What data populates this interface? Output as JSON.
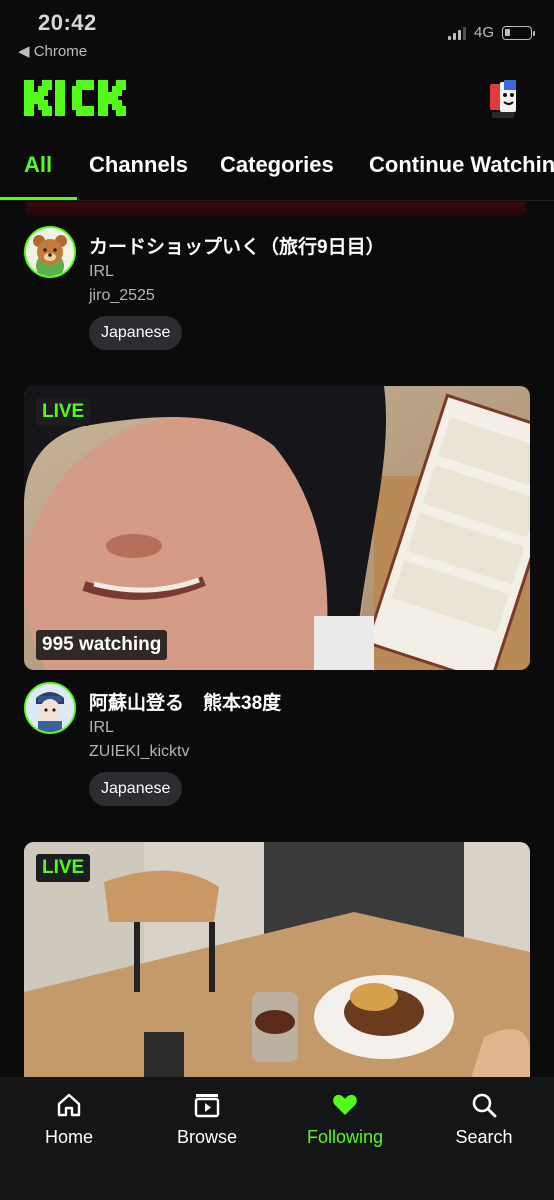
{
  "status_bar": {
    "time": "20:42",
    "back_label": "◀ Chrome",
    "network": "4G",
    "battery_level": 0.2
  },
  "header": {
    "logo_text": "KICK",
    "brand_color": "#53fc18"
  },
  "tabs": [
    {
      "label": "All",
      "active": true
    },
    {
      "label": "Channels",
      "active": false
    },
    {
      "label": "Categories",
      "active": false
    },
    {
      "label": "Continue Watching",
      "active": false
    }
  ],
  "streams": [
    {
      "title": "カードショップいく（旅行9日目）",
      "category": "IRL",
      "channel": "jiro_2525",
      "tag": "Japanese",
      "avatar_icon": "bear-avatar-icon"
    },
    {
      "live_label": "LIVE",
      "viewers": "995 watching",
      "title": "阿蘇山登る　熊本38度",
      "category": "IRL",
      "channel": "ZUIEKI_kicktv",
      "tag": "Japanese",
      "avatar_icon": "character-avatar-icon"
    },
    {
      "live_label": "LIVE"
    }
  ],
  "bottom_nav": [
    {
      "label": "Home",
      "icon": "home-icon",
      "active": false
    },
    {
      "label": "Browse",
      "icon": "browse-icon",
      "active": false
    },
    {
      "label": "Following",
      "icon": "heart-icon",
      "active": true
    },
    {
      "label": "Search",
      "icon": "search-icon",
      "active": false
    }
  ]
}
